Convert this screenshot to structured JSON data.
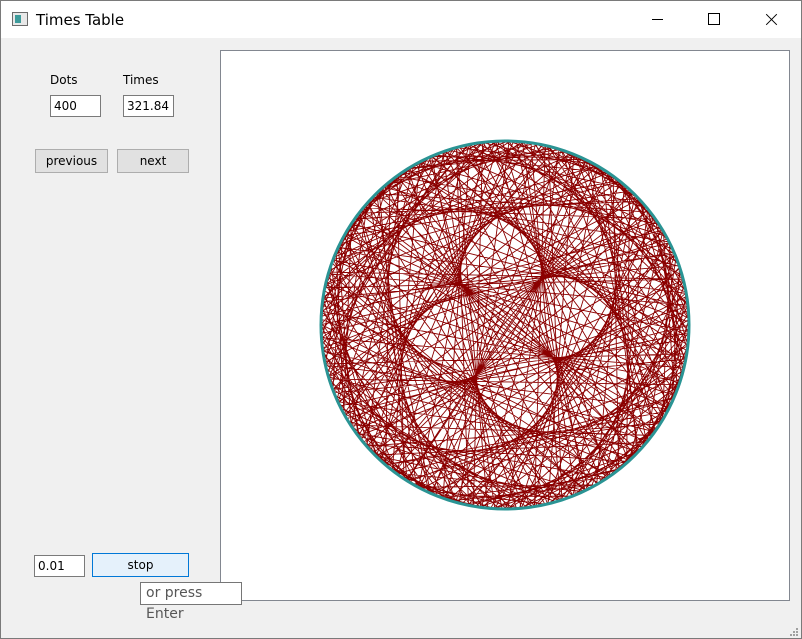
{
  "window": {
    "title": "Times Table",
    "icon": "app-window-icon",
    "controls": [
      "minimize-icon",
      "maximize-icon",
      "close-icon"
    ]
  },
  "controls": {
    "dots_label": "Dots",
    "dots_value": "400",
    "times_label": "Times",
    "times_value": "321.84",
    "previous_label": "previous",
    "next_label": "next",
    "step_value": "0.01",
    "stop_label": "stop",
    "tooltip": "or press Enter"
  },
  "visualization": {
    "dots": 400,
    "multiplier": 321.84,
    "circle_color": "#2a9494",
    "line_color": "#8b0000"
  }
}
